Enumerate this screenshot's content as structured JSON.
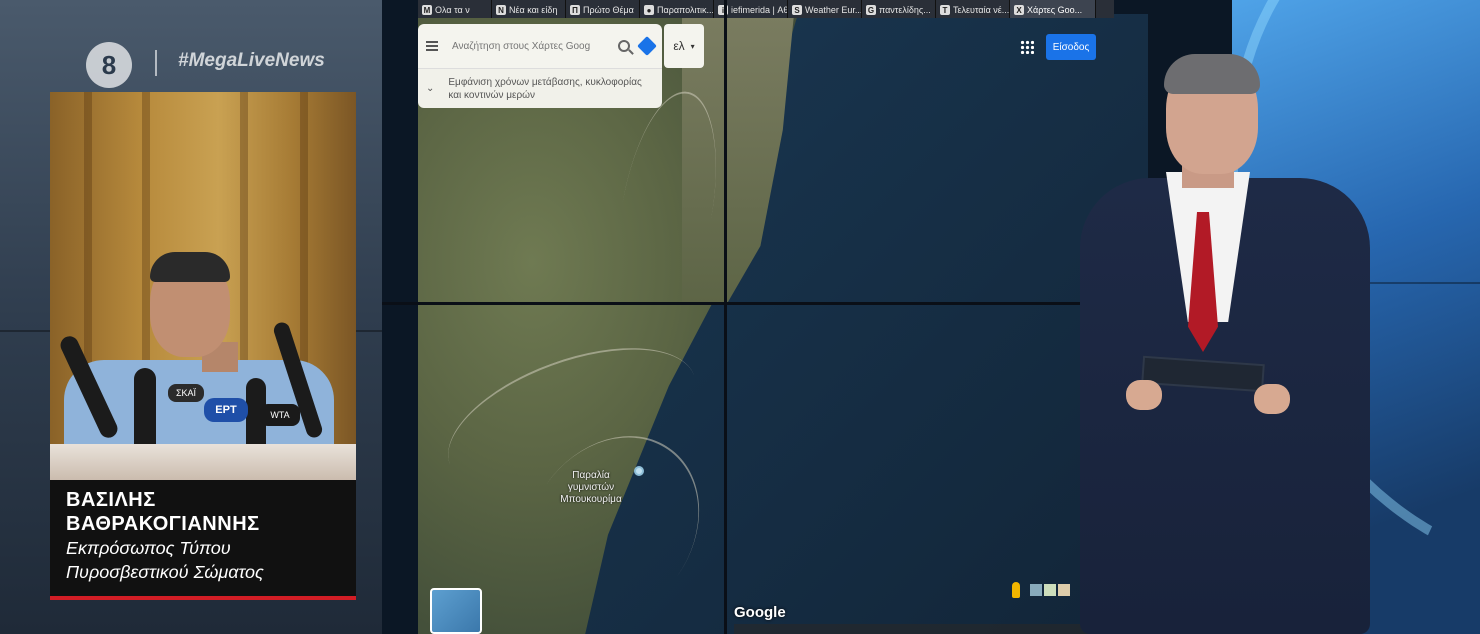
{
  "channel": {
    "logo_text": "8",
    "hashtag": "#MegaLiveNews"
  },
  "lower_third": {
    "name_line1": "ΒΑΣΙΛΗΣ",
    "name_line2": "ΒΑΘΡΑΚΟΓΙΑΝΝΗΣ",
    "title_line1": "Εκπρόσωπος Τύπου",
    "title_line2": "Πυροσβεστικού Σώματος",
    "accent_color": "#d21d25"
  },
  "inset_mics": {
    "ert": "ΕΡΤ",
    "skai": "ΣΚΑΪ",
    "mega": "WTA"
  },
  "browser": {
    "tabs": [
      {
        "icon": "M",
        "label": "Ολα τα ν"
      },
      {
        "icon": "N",
        "label": "Νέα και είδη"
      },
      {
        "icon": "Π",
        "label": "Πρώτο Θέμα"
      },
      {
        "icon": "●",
        "label": "Παραπολιτικ..."
      },
      {
        "icon": "i",
        "label": "iefimerida | Αθλ..."
      },
      {
        "icon": "S",
        "label": "Weather Eur..."
      },
      {
        "icon": "G",
        "label": "παντελίδης..."
      },
      {
        "icon": "T",
        "label": "Τελευταία νέ..."
      },
      {
        "icon": "X",
        "label": "Χάρτες Goo..."
      }
    ]
  },
  "maps": {
    "search_placeholder": "Αναζήτηση στους Χάρτες Goog",
    "language": "ελ",
    "traffic_hint": "Εμφάνιση χρόνων μετάβασης, κυκλοφορίας και κοντινών μερών",
    "signin_label": "Είσοδος",
    "place_label": "Παραλία γυμνιστών Μπουκουρίμα",
    "google_logo": "Google",
    "zoom_in": "+",
    "zoom_out": "−"
  }
}
